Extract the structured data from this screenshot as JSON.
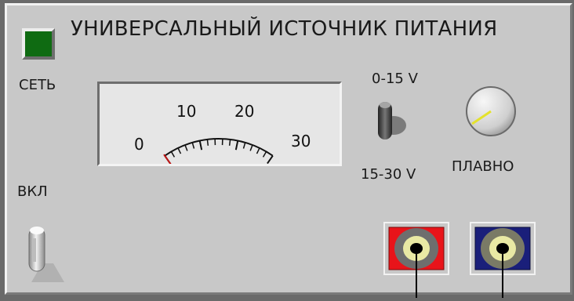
{
  "panel": {
    "title": "УНИВЕРСАЛЬНЫЙ ИСТОЧНИК ПИТАНИЯ",
    "power_label": "СЕТЬ",
    "on_label": "ВКЛ",
    "smooth_label": "ПЛАВНО",
    "range_low_label": "0-15 V",
    "range_high_label": "15-30 V",
    "power_led_color": "#0f6b12"
  },
  "meter": {
    "scale_min": 0,
    "scale_max": 30,
    "tick_labels": [
      "0",
      "10",
      "20",
      "30"
    ],
    "needle_value": 0
  },
  "controls": {
    "smooth_knob_icon": "rotary-knob",
    "red_terminal_color": "#e8141a",
    "blue_terminal_color": "#1a1f7a"
  }
}
